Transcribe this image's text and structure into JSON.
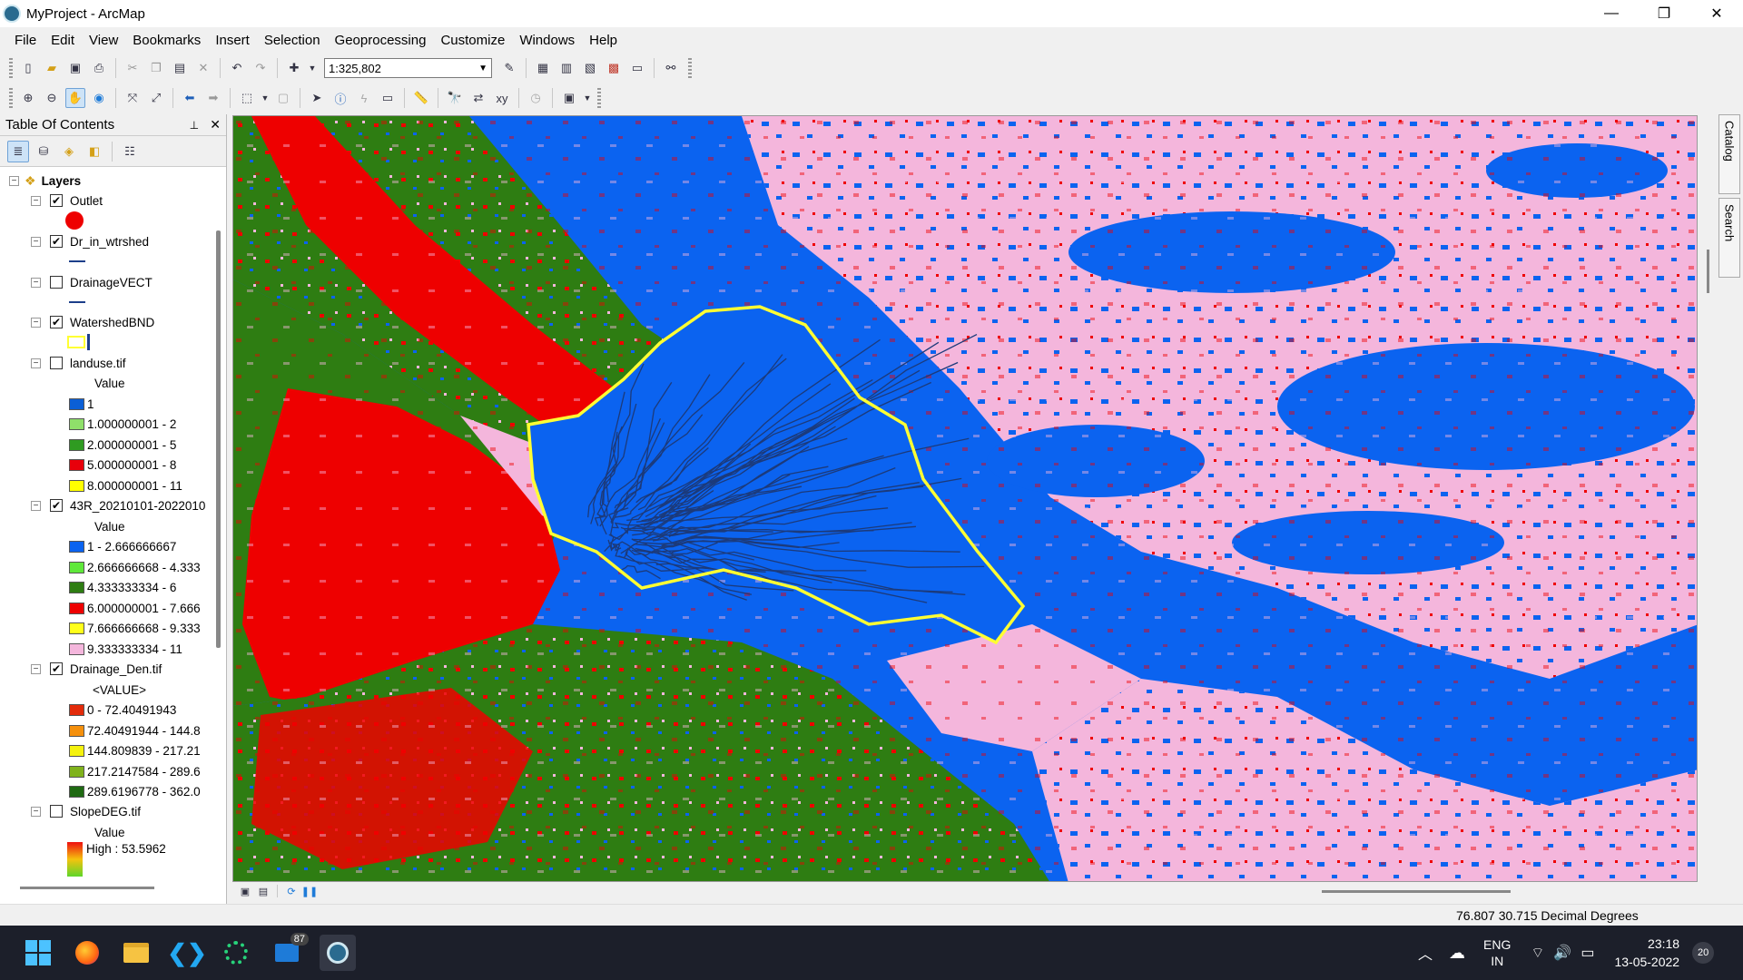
{
  "window": {
    "title": "MyProject - ArcMap",
    "controls": [
      "—",
      "❐",
      "✕"
    ]
  },
  "menu": [
    "File",
    "Edit",
    "View",
    "Bookmarks",
    "Insert",
    "Selection",
    "Geoprocessing",
    "Customize",
    "Windows",
    "Help"
  ],
  "standard_toolbar": {
    "scale": "1:325,802"
  },
  "toc": {
    "title": "Table Of Contents",
    "root": "Layers",
    "layers": [
      {
        "name": "Outlet",
        "checked": "✔"
      },
      {
        "name": "Dr_in_wtrshed",
        "checked": "✔"
      },
      {
        "name": "DrainageVECT",
        "checked": ""
      },
      {
        "name": "WatershedBND",
        "checked": "✔"
      },
      {
        "name": "landuse.tif",
        "checked": "",
        "header": "Value",
        "classes": [
          {
            "label": "1",
            "color": "#0b5fd6"
          },
          {
            "label": "1.000000001 - 2",
            "color": "#8fe06a"
          },
          {
            "label": "2.000000001 - 5",
            "color": "#2f9b21"
          },
          {
            "label": "5.000000001 - 8",
            "color": "#e8000b"
          },
          {
            "label": "8.000000001 - 11",
            "color": "#ffff00"
          }
        ]
      },
      {
        "name": "43R_20210101-2022010",
        "checked": "✔",
        "header": "Value",
        "classes": [
          {
            "label": "1 - 2.666666667",
            "color": "#0b63f0"
          },
          {
            "label": "2.666666668 - 4.333",
            "color": "#5fe83a"
          },
          {
            "label": "4.333333334 - 6",
            "color": "#2e7d12"
          },
          {
            "label": "6.000000001 - 7.666",
            "color": "#ee0000"
          },
          {
            "label": "7.666666668 - 9.333",
            "color": "#ffff1a"
          },
          {
            "label": "9.333333334 - 11",
            "color": "#f4b6dc"
          }
        ]
      },
      {
        "name": "Drainage_Den.tif",
        "checked": "✔",
        "header": "<VALUE>",
        "classes": [
          {
            "label": "0 - 72.40491943",
            "color": "#e32b0a"
          },
          {
            "label": "72.40491944 - 144.8",
            "color": "#f5900c"
          },
          {
            "label": "144.809839 - 217.21",
            "color": "#f5f20e"
          },
          {
            "label": "217.2147584 - 289.6",
            "color": "#7fb21b"
          },
          {
            "label": "289.6196778 - 362.0",
            "color": "#1f6a12"
          }
        ]
      },
      {
        "name": "SlopeDEG.tif",
        "checked": "",
        "header": "Value",
        "high": "High : 53.5962"
      }
    ]
  },
  "dock_tabs": [
    "Catalog",
    "Search"
  ],
  "status": {
    "coords": "76.807  30.715 Decimal Degrees"
  },
  "taskbar": {
    "badge": "87",
    "lang1": "ENG",
    "lang2": "IN",
    "time": "23:18",
    "date": "13-05-2022",
    "notif": "20"
  },
  "colors": {
    "water_blue": "#0b63f0",
    "pink": "#f4b6dc",
    "red": "#ee0000",
    "forest": "#2e7d12",
    "boundary": "#ffff33"
  }
}
